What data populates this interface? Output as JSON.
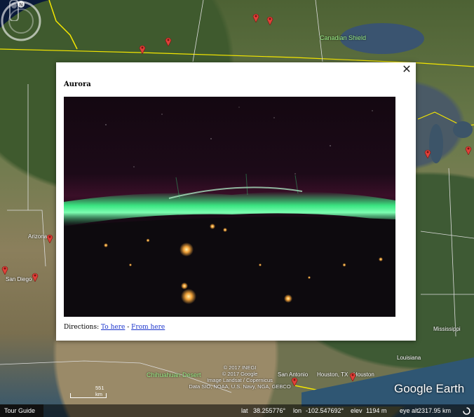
{
  "map": {
    "places": [
      {
        "name": "Canadian Shield",
        "style": "green"
      },
      {
        "name": "Chihuahuan Desert",
        "style": "green"
      },
      {
        "name": "San Antonio",
        "style": "white"
      },
      {
        "name": "Houston, TX",
        "style": "white"
      },
      {
        "name": "Houston",
        "style": "white"
      },
      {
        "name": "Mississippi",
        "style": "white"
      },
      {
        "name": "Louisiana",
        "style": "white"
      },
      {
        "name": "Arizona",
        "style": "white"
      },
      {
        "name": "San Diego",
        "style": "white"
      }
    ],
    "scale_label": "551 km",
    "attribution": [
      "© 2017 INEGI",
      "© 2017 Google",
      "Image Landsat / Copernicus",
      "Data SIO, NOAA, U.S. Navy, NGA, GEBCO"
    ],
    "logo": "Google Earth",
    "compass_north": "N"
  },
  "popup": {
    "title": "Aurora",
    "close_glyph": "✕",
    "directions_label": "Directions:",
    "to_here": "To here",
    "separator": "-",
    "from_here": "From here"
  },
  "status": {
    "tour_guide": "Tour Guide",
    "lat_label": "lat",
    "lat_value": "38.255776°",
    "lon_label": "lon",
    "lon_value": "-102.547692°",
    "elev_label": "elev",
    "elev_value": "1194 m",
    "eye_alt_label": "eye alt",
    "eye_alt_value": "2317.95 km"
  },
  "colors": {
    "aurora_green": "#3dfc8c",
    "pin_red": "#e0413a",
    "border_yellow": "#f4e600"
  }
}
